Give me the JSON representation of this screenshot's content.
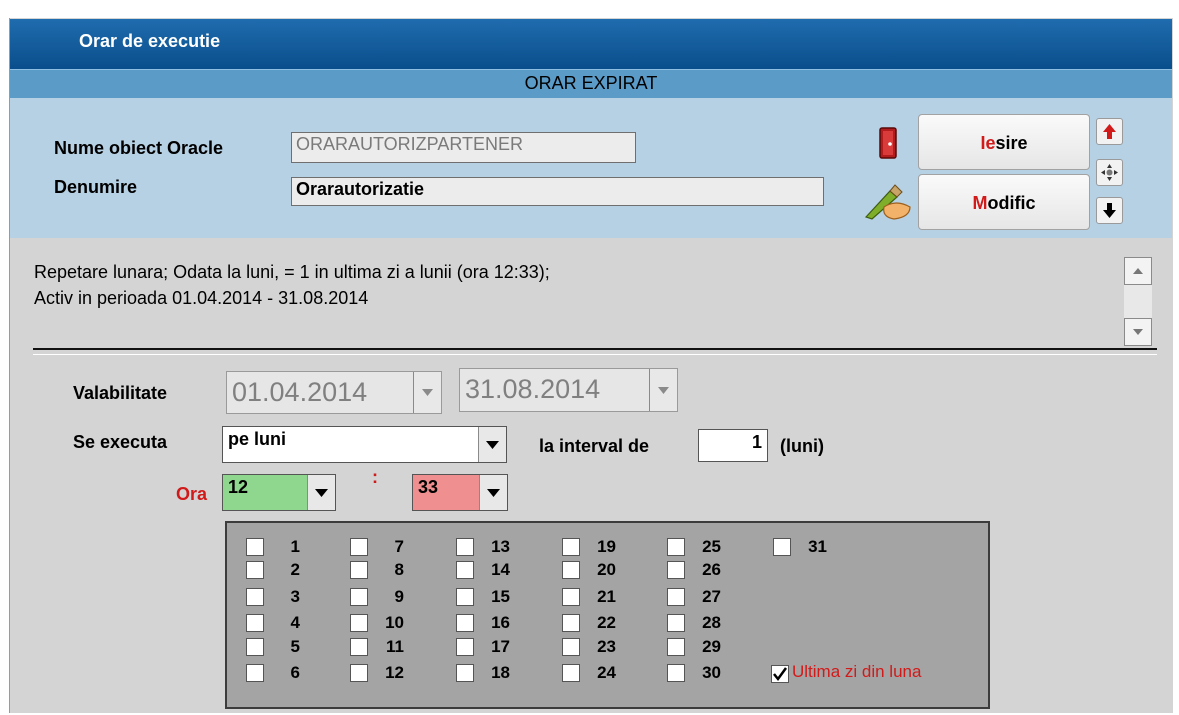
{
  "window": {
    "title": "Orar de executie",
    "status": "ORAR EXPIRAT"
  },
  "header": {
    "object_label": "Nume obiect Oracle",
    "object_value": "ORARAUTORIZPARTENER",
    "name_label": "Denumire",
    "name_value": "Orarautorizatie"
  },
  "buttons": {
    "exit_hot": "Ie",
    "exit_rest": "sire",
    "modify_hot": "M",
    "modify_rest": "odific"
  },
  "description": {
    "line1": "Repetare lunara; Odata la luni,  = 1 in ultima zi a lunii (ora 12:33);",
    "line2": "Activ in perioada 01.04.2014 - 31.08.2014"
  },
  "form": {
    "validity_label": "Valabilitate",
    "date_from": "01.04.2014",
    "date_to": "31.08.2014",
    "exec_label": "Se executa",
    "exec_value": "pe luni",
    "interval_label": "la interval de",
    "interval_value": "1",
    "interval_unit": "(luni)",
    "hour_label": "Ora",
    "hour_value": "12",
    "separator": ":",
    "minute_value": "33",
    "hour_color": "#8fd68f",
    "minute_color": "#f08f8f"
  },
  "days": {
    "items": [
      {
        "day": "1",
        "checked": false
      },
      {
        "day": "2",
        "checked": false
      },
      {
        "day": "3",
        "checked": false
      },
      {
        "day": "4",
        "checked": false
      },
      {
        "day": "5",
        "checked": false
      },
      {
        "day": "6",
        "checked": false
      },
      {
        "day": "7",
        "checked": false
      },
      {
        "day": "8",
        "checked": false
      },
      {
        "day": "9",
        "checked": false
      },
      {
        "day": "10",
        "checked": false
      },
      {
        "day": "11",
        "checked": false
      },
      {
        "day": "12",
        "checked": false
      },
      {
        "day": "13",
        "checked": false
      },
      {
        "day": "14",
        "checked": false
      },
      {
        "day": "15",
        "checked": false
      },
      {
        "day": "16",
        "checked": false
      },
      {
        "day": "17",
        "checked": false
      },
      {
        "day": "18",
        "checked": false
      },
      {
        "day": "19",
        "checked": false
      },
      {
        "day": "20",
        "checked": false
      },
      {
        "day": "21",
        "checked": false
      },
      {
        "day": "22",
        "checked": false
      },
      {
        "day": "23",
        "checked": false
      },
      {
        "day": "24",
        "checked": false
      },
      {
        "day": "25",
        "checked": false
      },
      {
        "day": "26",
        "checked": false
      },
      {
        "day": "27",
        "checked": false
      },
      {
        "day": "28",
        "checked": false
      },
      {
        "day": "29",
        "checked": false
      },
      {
        "day": "30",
        "checked": false
      },
      {
        "day": "31",
        "checked": false
      }
    ],
    "last_day_label": "Ultima zi din luna",
    "last_day_checked": true
  },
  "icons": [
    "door-exit-icon",
    "pencil-hand-icon",
    "arrow-up-icon",
    "move-icon",
    "arrow-down-icon",
    "scroll-up-icon",
    "scroll-down-icon",
    "chevron-down-icon",
    "checkmark-icon"
  ]
}
